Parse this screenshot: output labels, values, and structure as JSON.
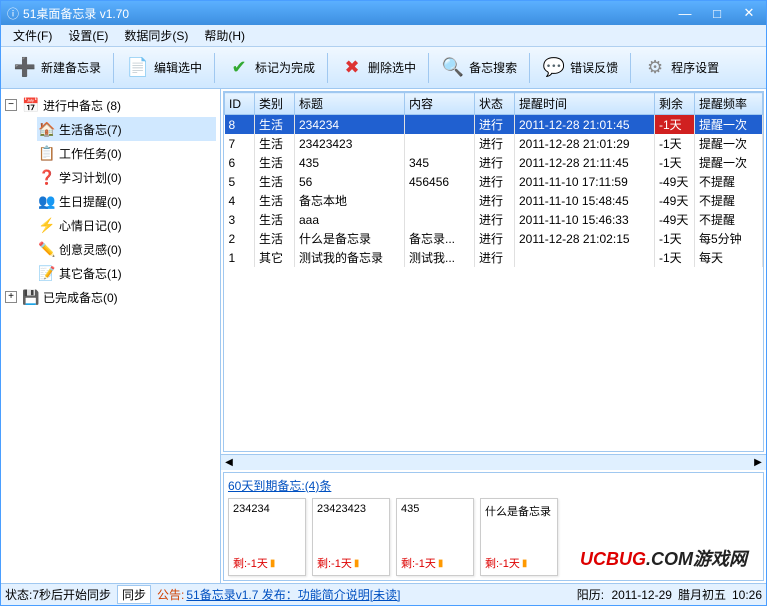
{
  "titlebar": {
    "app_icon": "ⓘ",
    "title": "51桌面备忘录  v1.70"
  },
  "menu": {
    "file": "文件(F)",
    "settings": "设置(E)",
    "sync": "数据同步(S)",
    "help": "帮助(H)"
  },
  "toolbar": {
    "new": "新建备忘录",
    "edit": "编辑选中",
    "complete": "标记为完成",
    "delete": "删除选中",
    "search": "备忘搜索",
    "feedback": "错误反馈",
    "appset": "程序设置"
  },
  "sidebar": {
    "inprogress": "进行中备忘 (8)",
    "items": [
      {
        "label": "生活备忘(7)",
        "icon": "🏠"
      },
      {
        "label": "工作任务(0)",
        "icon": "📋"
      },
      {
        "label": "学习计划(0)",
        "icon": "❓"
      },
      {
        "label": "生日提醒(0)",
        "icon": "👥"
      },
      {
        "label": "心情日记(0)",
        "icon": "⚡"
      },
      {
        "label": "创意灵感(0)",
        "icon": "✏️"
      },
      {
        "label": "其它备忘(1)",
        "icon": "📝"
      }
    ],
    "completed": "已完成备忘(0)"
  },
  "grid": {
    "headers": {
      "id": "ID",
      "cat": "类别",
      "title": "标题",
      "content": "内容",
      "status": "状态",
      "time": "提醒时间",
      "remain": "剩余",
      "freq": "提醒频率"
    },
    "rows": [
      {
        "id": "8",
        "cat": "生活",
        "title": "234234",
        "content": "",
        "status": "进行",
        "time": "2011-12-28 21:01:45",
        "remain": "-1天",
        "freq": "提醒一次",
        "sel": true
      },
      {
        "id": "7",
        "cat": "生活",
        "title": "23423423",
        "content": "",
        "status": "进行",
        "time": "2011-12-28 21:01:29",
        "remain": "-1天",
        "freq": "提醒一次"
      },
      {
        "id": "6",
        "cat": "生活",
        "title": "435",
        "content": "345",
        "status": "进行",
        "time": "2011-12-28 21:11:45",
        "remain": "-1天",
        "freq": "提醒一次"
      },
      {
        "id": "5",
        "cat": "生活",
        "title": "56",
        "content": "456456",
        "status": "进行",
        "time": "2011-11-10 17:11:59",
        "remain": "-49天",
        "freq": "不提醒"
      },
      {
        "id": "4",
        "cat": "生活",
        "title": "备忘本地",
        "content": "",
        "status": "进行",
        "time": "2011-11-10 15:48:45",
        "remain": "-49天",
        "freq": "不提醒"
      },
      {
        "id": "3",
        "cat": "生活",
        "title": "aaa",
        "content": "",
        "status": "进行",
        "time": "2011-11-10 15:46:33",
        "remain": "-49天",
        "freq": "不提醒"
      },
      {
        "id": "2",
        "cat": "生活",
        "title": "什么是备忘录",
        "content": "备忘录...",
        "status": "进行",
        "time": "2011-12-28 21:02:15",
        "remain": "-1天",
        "freq": "每5分钟"
      },
      {
        "id": "1",
        "cat": "其它",
        "title": "测试我的备忘录",
        "content": "测试我...",
        "status": "进行",
        "time": "",
        "remain": "-1天",
        "freq": "每天"
      }
    ]
  },
  "bottom": {
    "title_prefix": "60天到期备忘:",
    "title_count": "(4)条",
    "cards": [
      {
        "title": "234234",
        "remain": "剩:-1天"
      },
      {
        "title": "23423423",
        "remain": "剩:-1天"
      },
      {
        "title": "435",
        "remain": "剩:-1天"
      },
      {
        "title": "什么是备忘录",
        "remain": "剩:-1天"
      }
    ]
  },
  "status": {
    "state": "状态:7秒后开始同步",
    "sync_btn": "同步",
    "notice_label": "公告:",
    "notice_text": "51备忘录v1.7 发布：功能简介说明[未读]",
    "solar_label": "阳历:",
    "solar_date": "2011-12-29",
    "lunar": "腊月初五",
    "time": "10:26"
  },
  "watermark": {
    "brand": "UCBUG",
    "dot": ".",
    "domain": "COM",
    "zh": "游戏网"
  }
}
